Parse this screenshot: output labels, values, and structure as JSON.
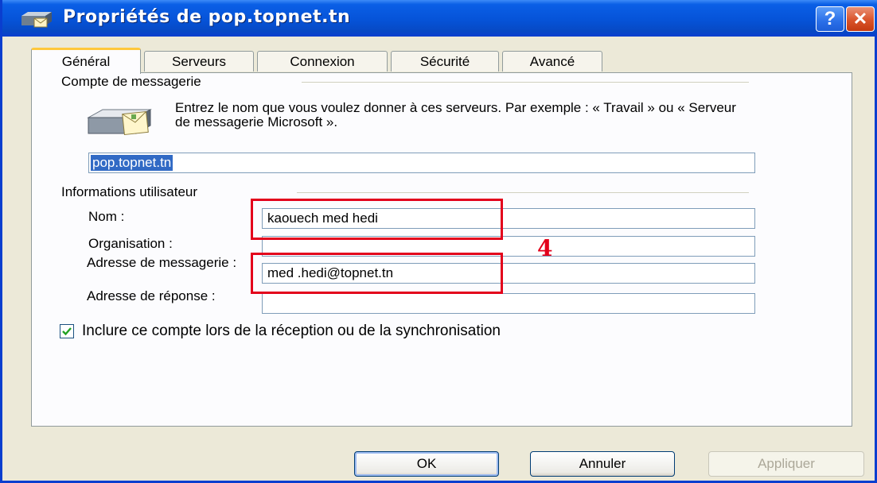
{
  "window": {
    "title": "Propriétés de pop.topnet.tn",
    "help_label": "?",
    "close_label": "✕"
  },
  "tabs": [
    {
      "label": "Général",
      "active": true
    },
    {
      "label": "Serveurs",
      "active": false
    },
    {
      "label": "Connexion",
      "active": false
    },
    {
      "label": "Sécurité",
      "active": false
    },
    {
      "label": "Avancé",
      "active": false
    }
  ],
  "account_group": {
    "title": "Compte de messagerie",
    "intro": "Entrez le nom que vous voulez donner à ces serveurs. Par exemple : « Travail » ou « Serveur de messagerie Microsoft ».",
    "account_name": "pop.topnet.tn",
    "icon": "mail-server-icon"
  },
  "user_group": {
    "title": "Informations utilisateur",
    "name_label": "Nom :",
    "name_value": "kaouech med hedi",
    "organisation_label": "Organisation :",
    "organisation_value": "",
    "email_label": "Adresse de messagerie :",
    "email_value": "med .hedi@topnet.tn",
    "reply_label": "Adresse de réponse :",
    "reply_value": ""
  },
  "include_account": {
    "label": "Inclure ce compte lors de la réception ou de la synchronisation",
    "checked": true
  },
  "annotation": {
    "marker": "4",
    "color": "#e3001b"
  },
  "buttons": {
    "ok": "OK",
    "cancel": "Annuler",
    "apply": "Appliquer"
  }
}
